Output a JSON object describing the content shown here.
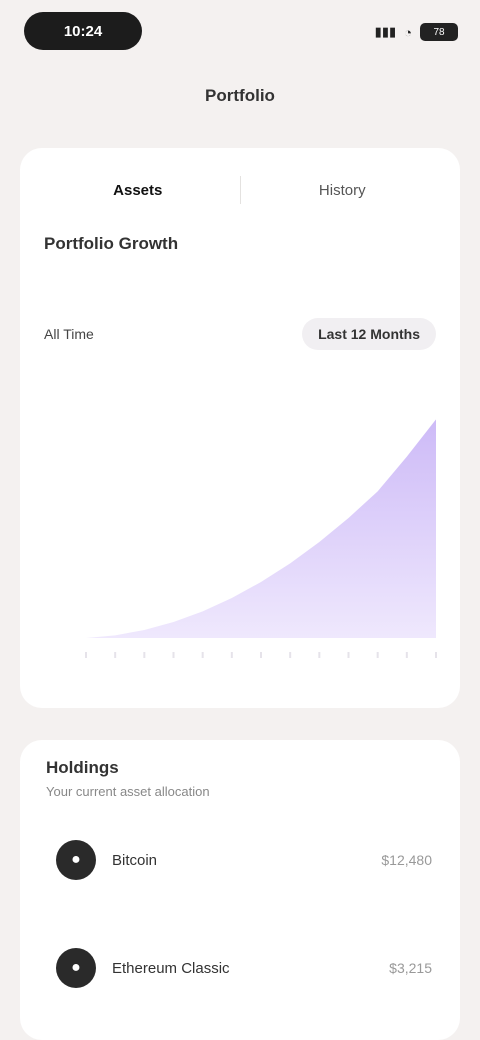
{
  "status": {
    "time": "10:24",
    "signal": "▮▮▮",
    "wifi": "◔",
    "battery": "78"
  },
  "nav": {
    "title": "Portfolio"
  },
  "tabs": [
    {
      "label": "Assets"
    },
    {
      "label": "History"
    }
  ],
  "overview": {
    "title": "Portfolio Growth"
  },
  "filters": {
    "left": "All Time",
    "right": "Last 12 Months"
  },
  "chart_data": {
    "type": "area",
    "x": [
      1,
      2,
      3,
      4,
      5,
      6,
      7,
      8,
      9,
      10,
      11,
      12,
      13
    ],
    "values": [
      0,
      1,
      3,
      6,
      10,
      15,
      21,
      28,
      36,
      45,
      55,
      68,
      82
    ],
    "ylim": [
      0,
      90
    ],
    "fill_top": "#cdbaf7",
    "fill_bottom": "#efe8fd",
    "grid": false
  },
  "holdings": {
    "title": "Holdings",
    "subtitle": "Your current asset allocation",
    "items": [
      {
        "name": "Bitcoin",
        "value": "$12,480",
        "icon": "coin-icon"
      },
      {
        "name": "Ethereum Classic",
        "value": "$3,215",
        "icon": "coin-icon"
      }
    ]
  }
}
